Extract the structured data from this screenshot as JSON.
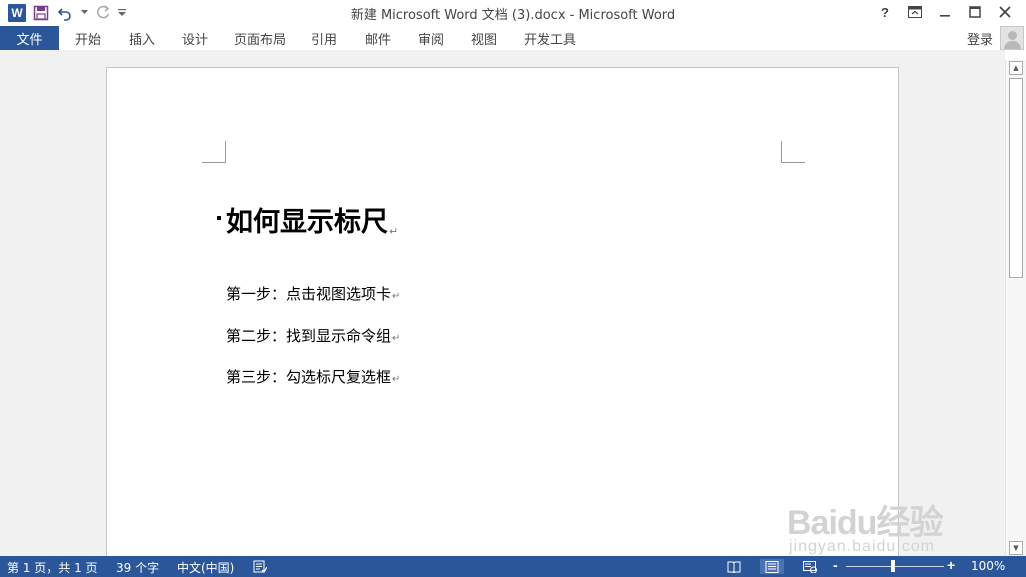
{
  "window": {
    "title": "新建 Microsoft Word 文档 (3).docx - Microsoft Word",
    "app_icon_letter": "W",
    "help": "?",
    "accent_color": "#2b579a"
  },
  "ribbon": {
    "tabs": [
      {
        "label": "文件"
      },
      {
        "label": "开始"
      },
      {
        "label": "插入"
      },
      {
        "label": "设计"
      },
      {
        "label": "页面布局"
      },
      {
        "label": "引用"
      },
      {
        "label": "邮件"
      },
      {
        "label": "审阅"
      },
      {
        "label": "视图"
      },
      {
        "label": "开发工具"
      }
    ],
    "login": "登录"
  },
  "document": {
    "heading": "如何显示标尺",
    "paragraphs": [
      "第一步：点击视图选项卡",
      "第二步：找到显示命令组",
      "第三步：勾选标尺复选框"
    ],
    "paragraph_mark": "↵"
  },
  "watermark": {
    "logo": "Baidu经验",
    "url": "jingyan.baidu.com"
  },
  "statusbar": {
    "page": "第 1 页，共 1 页",
    "words": "39 个字",
    "language": "中文(中国)",
    "zoom": "100%",
    "zoom_minus": "-",
    "zoom_plus": "+"
  }
}
